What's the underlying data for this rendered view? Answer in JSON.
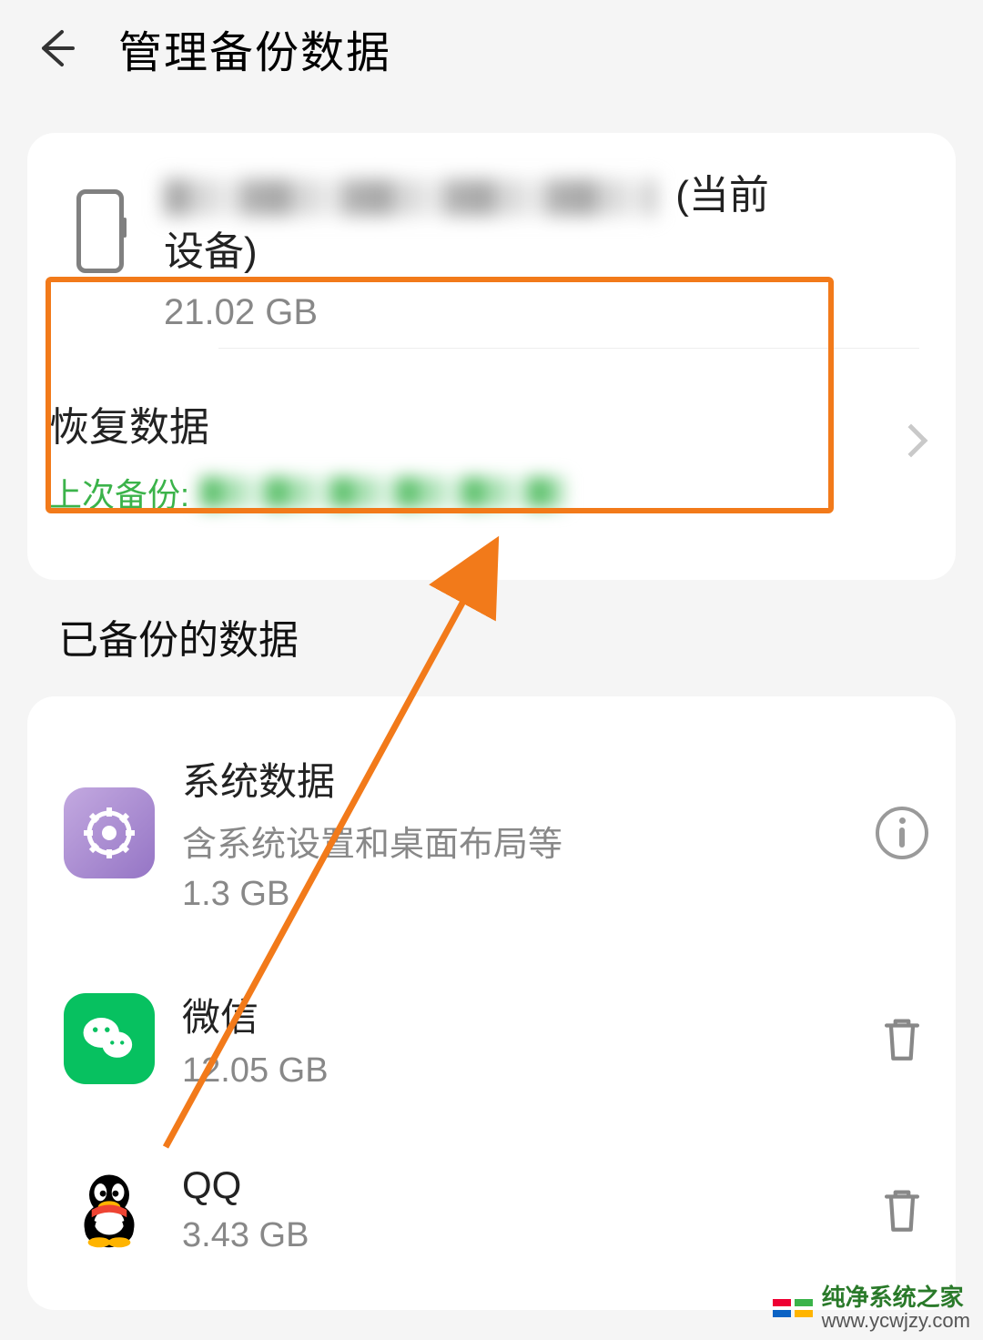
{
  "header": {
    "title": "管理备份数据"
  },
  "device": {
    "name_suffix_line1": "(当前",
    "name_suffix_line2": "设备)",
    "size": "21.02 GB"
  },
  "restore": {
    "title": "恢复数据",
    "last_backup_label": "上次备份:"
  },
  "section": {
    "backed_up_title": "已备份的数据"
  },
  "apps": [
    {
      "name": "系统数据",
      "desc": "含系统设置和桌面布局等",
      "size": "1.3 GB",
      "icon": "gear",
      "action": "info"
    },
    {
      "name": "微信",
      "desc": "",
      "size": "12.05 GB",
      "icon": "wechat",
      "action": "delete"
    },
    {
      "name": "QQ",
      "desc": "",
      "size": "3.43 GB",
      "icon": "qq",
      "action": "delete"
    }
  ],
  "watermark": {
    "title": "纯净系统之家",
    "url": "www.ycwjzy.com"
  }
}
